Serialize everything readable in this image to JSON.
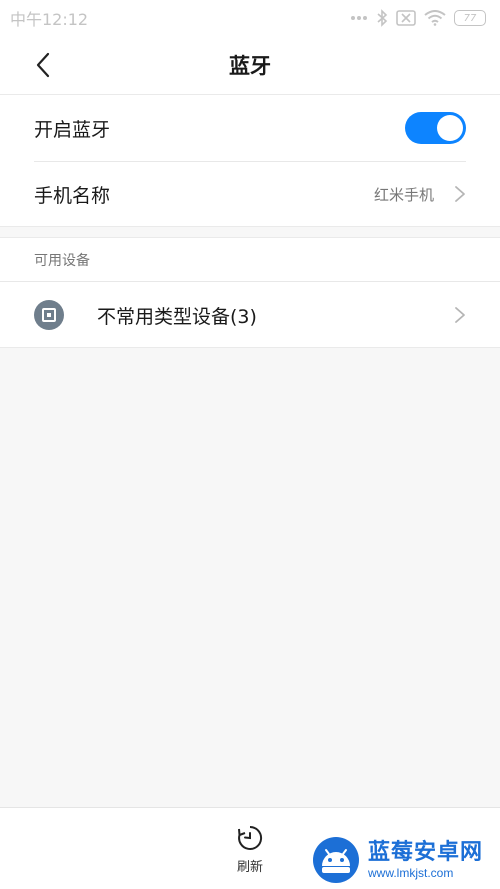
{
  "status_bar": {
    "time": "中午12:12",
    "icons": [
      "dots-icon",
      "bluetooth-icon",
      "no-sim-icon",
      "wifi-icon"
    ],
    "battery": "77"
  },
  "header": {
    "back_icon": "back-chevron-icon",
    "title": "蓝牙"
  },
  "settings": {
    "bluetooth_toggle": {
      "label": "开启蓝牙",
      "enabled": true
    },
    "device_name": {
      "label": "手机名称",
      "value": "红米手机"
    }
  },
  "available_devices": {
    "section_title": "可用设备",
    "items": [
      {
        "label": "不常用类型设备(3)",
        "icon": "device-icon"
      }
    ]
  },
  "bottom_bar": {
    "refresh_label": "刷新",
    "refresh_icon": "refresh-icon"
  },
  "watermark": {
    "title": "蓝莓安卓网",
    "url": "www.lmkjst.com"
  },
  "colors": {
    "accent": "#0d84ff",
    "background": "#f7f7f7",
    "device_icon": "#6f7e8c",
    "watermark": "#1c6fd6"
  }
}
